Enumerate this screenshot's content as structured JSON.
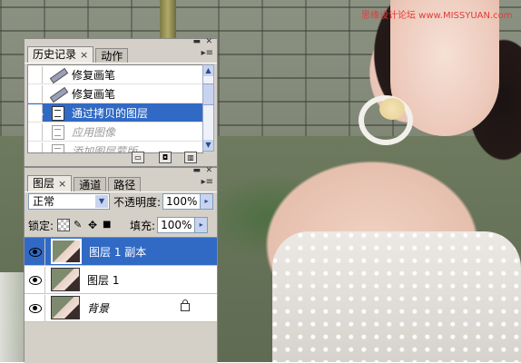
{
  "watermark": "思缘设计论坛 www.MISSYUAN.com",
  "history_panel": {
    "tabs": [
      {
        "label": "历史记录",
        "active": true,
        "closable": true
      },
      {
        "label": "动作",
        "active": false,
        "closable": false
      }
    ],
    "items": [
      {
        "label": "修复画笔",
        "icon": "healing-brush-icon",
        "state": "normal"
      },
      {
        "label": "修复画笔",
        "icon": "healing-brush-icon",
        "state": "normal"
      },
      {
        "label": "通过拷贝的图层",
        "icon": "document-icon",
        "state": "selected"
      },
      {
        "label": "应用图像",
        "icon": "document-icon",
        "state": "dimmed"
      },
      {
        "label": "添加图层蒙版",
        "icon": "document-icon",
        "state": "dimmed"
      }
    ],
    "footer_icons": [
      "new-document-from-state-icon",
      "new-snapshot-icon",
      "trash-icon"
    ]
  },
  "layers_panel": {
    "tabs": [
      {
        "label": "图层",
        "active": true,
        "closable": true
      },
      {
        "label": "通道",
        "active": false,
        "closable": false
      },
      {
        "label": "路径",
        "active": false,
        "closable": false
      }
    ],
    "blend_mode": "正常",
    "opacity_label": "不透明度:",
    "opacity_value": "100%",
    "lock_label": "锁定:",
    "fill_label": "填充:",
    "fill_value": "100%",
    "layers": [
      {
        "name": "图层 1 副本",
        "visible": true,
        "selected": true,
        "locked": false
      },
      {
        "name": "图层 1",
        "visible": true,
        "selected": false,
        "locked": false
      },
      {
        "name": "背景",
        "visible": true,
        "selected": false,
        "locked": true
      }
    ]
  },
  "colors": {
    "selection": "#316ac5",
    "panel_bg": "#d4d0c8",
    "watermark": "#e23b3b"
  }
}
